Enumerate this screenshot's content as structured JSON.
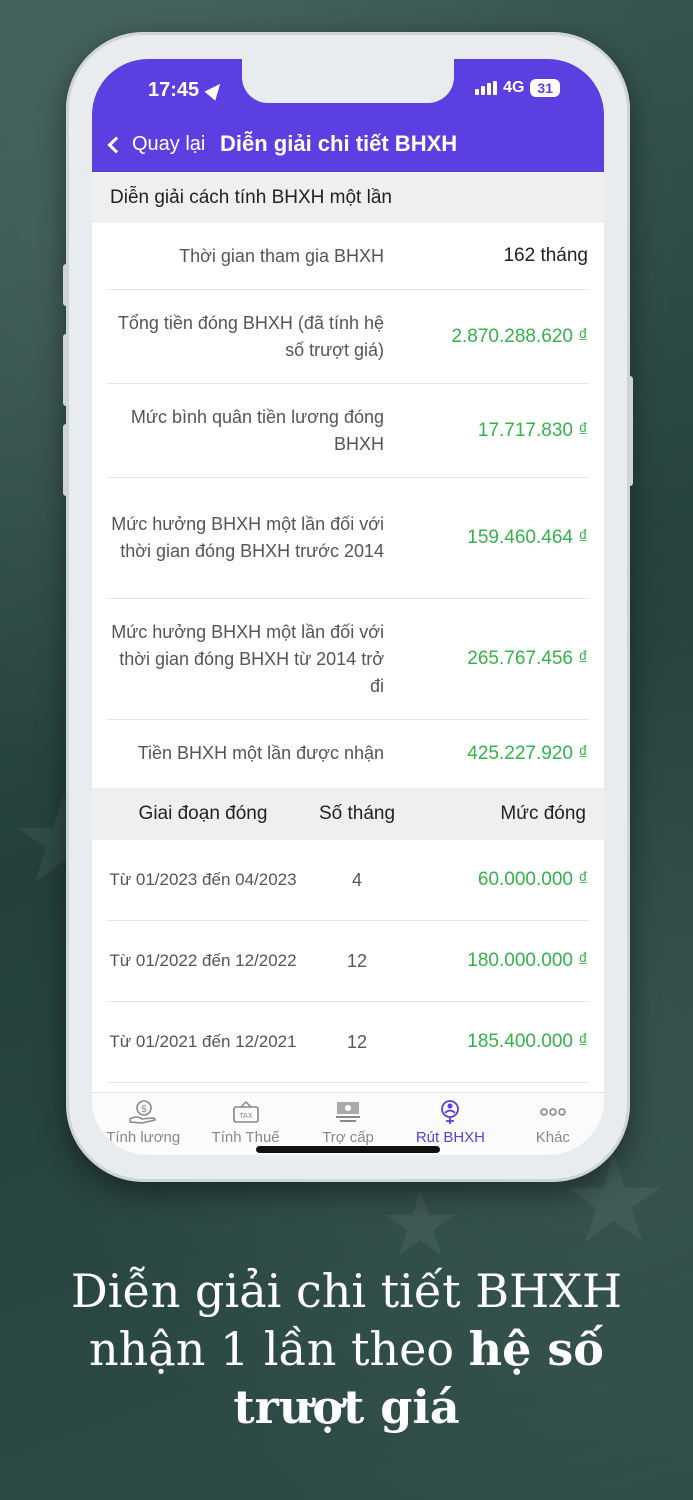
{
  "status": {
    "time": "17:45",
    "network": "4G",
    "battery": "31"
  },
  "nav": {
    "back_label": "Quay lại",
    "title": "Diễn giải chi tiết BHXH"
  },
  "section": {
    "title": "Diễn giải cách tính BHXH một lần"
  },
  "summary": [
    {
      "label": "Thời gian tham gia BHXH",
      "value": "162 tháng"
    },
    {
      "label": "Tổng tiền đóng BHXH (đã tính hệ số trượt giá)",
      "value": "2.870.288.620 ₫"
    },
    {
      "label": "Mức bình quân tiền lương đóng BHXH",
      "value": "17.717.830 ₫"
    },
    {
      "label": "Mức hưởng BHXH một lần đối với thời gian đóng BHXH trước 2014",
      "value": "159.460.464 ₫"
    },
    {
      "label": "Mức hưởng BHXH một lần đối với thời gian đóng BHXH từ 2014 trở đi",
      "value": "265.767.456 ₫"
    },
    {
      "label": "Tiền BHXH một lần được nhận",
      "value": "425.227.920 ₫"
    }
  ],
  "table": {
    "headers": [
      "Giai đoạn đóng",
      "Số tháng",
      "Mức đóng"
    ],
    "rows": [
      {
        "period": "Từ 01/2023 đến 04/2023",
        "months": "4",
        "amount": "60.000.000 ₫"
      },
      {
        "period": "Từ 01/2022 đến 12/2022",
        "months": "12",
        "amount": "180.000.000 ₫"
      },
      {
        "period": "Từ 01/2021 đến 12/2021",
        "months": "12",
        "amount": "185.400.000 ₫"
      }
    ]
  },
  "tabs": [
    {
      "label": "Tính lương",
      "icon": "salary-icon"
    },
    {
      "label": "Tính Thuế",
      "icon": "tax-icon"
    },
    {
      "label": "Trợ cấp",
      "icon": "allowance-icon"
    },
    {
      "label": "Rút BHXH",
      "icon": "insurance-icon",
      "active": true
    },
    {
      "label": "Khác",
      "icon": "more-icon"
    }
  ],
  "caption": {
    "line1": "Diễn giải chi tiết BHXH",
    "line2_prefix": "nhận 1 lần theo ",
    "line2_bold": "hệ số",
    "line3_bold": "trượt giá"
  },
  "colors": {
    "accent": "#5b3fe0",
    "money": "#34b24a"
  }
}
